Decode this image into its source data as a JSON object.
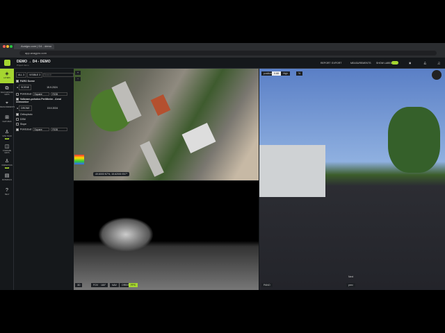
{
  "browser": {
    "tab_title": "Avalgro.com | D4 - demo",
    "url": "app.avagpro.com"
  },
  "header": {
    "title": "DEMO → D4 - DEMO",
    "subtitle": "Project demo",
    "report": "REPORT",
    "export": "EXPORT",
    "measurements": "MEASUREMENTS",
    "show_labels": "SHOW LABELS"
  },
  "sidebar": {
    "items": [
      {
        "label": "LAYERS"
      },
      {
        "label": "BACKGROUND MAPS"
      },
      {
        "label": "MEASUREMENTS"
      },
      {
        "label": "FEATURES"
      },
      {
        "label": "SITE TOUR",
        "badge": "NEW"
      },
      {
        "label": "COMPARE MAPS"
      },
      {
        "label": "INSPECTION",
        "badge": "NEW"
      },
      {
        "label": "MATERIALS"
      },
      {
        "label": "HELP"
      }
    ]
  },
  "layers": {
    "filter_all": "ALL 3",
    "filter_visible": "VISIBLE 3",
    "search_placeholder": "Search",
    "group1": {
      "name": "FARO Scene",
      "tag": "SCENE",
      "date": "15.9.2024",
      "pointcloud": "Pointcloud",
      "style": "Square",
      "color": "RGB"
    },
    "group2": {
      "name": "Volbeam-pohotos Perlitheim - Areal nemocnice",
      "tag": "DRONE",
      "date": "15.9.2024",
      "orthophoto": "Orthophoto",
      "dsm": "DSM",
      "slope": "Slope",
      "pointcloud": "Pointcloud",
      "style": "Square",
      "color": "RGB"
    }
  },
  "map": {
    "coords": "49.6000 N7%, 15.62000 E07°"
  },
  "viewer": {
    "mode": "3D",
    "fov": "FOV",
    "angle": "180°",
    "nav": "NAV",
    "ortho": "ORBIT",
    "fps": "FPS"
  },
  "pano": {
    "position_label": "position",
    "position_value": "0.68",
    "quality": "High",
    "type": "PANO",
    "next": "Next",
    "prev": "prev"
  }
}
